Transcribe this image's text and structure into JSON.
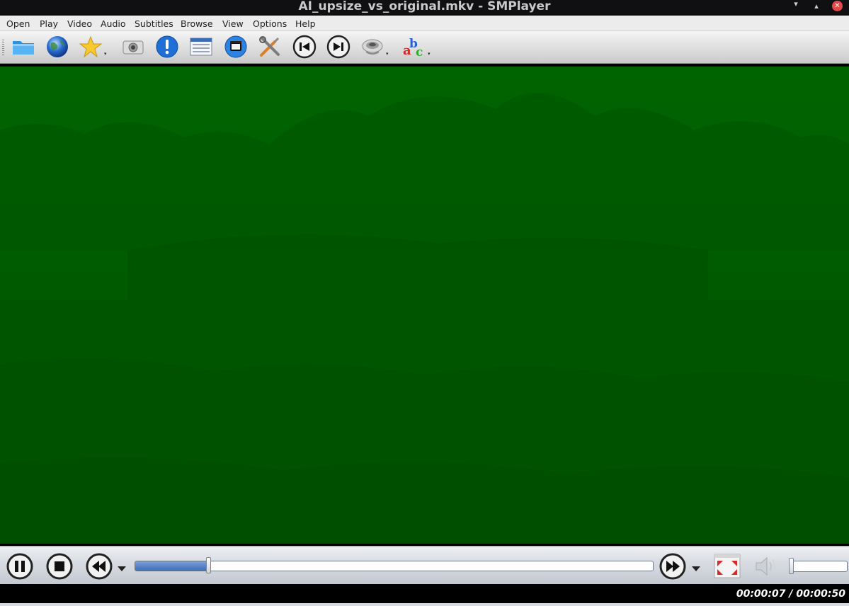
{
  "window": {
    "title": "AI_upsize_vs_original.mkv - SMPlayer",
    "controls": [
      "minimize-icon",
      "maximize-icon",
      "close-icon"
    ]
  },
  "menubar": {
    "items": [
      {
        "label": "Open"
      },
      {
        "label": "Play"
      },
      {
        "label": "Video"
      },
      {
        "label": "Audio"
      },
      {
        "label": "Subtitles"
      },
      {
        "label": "Browse"
      },
      {
        "label": "View"
      },
      {
        "label": "Options"
      },
      {
        "label": "Help"
      }
    ]
  },
  "toolbar": {
    "buttons": [
      {
        "icon": "open-folder-icon"
      },
      {
        "icon": "globe-url-icon"
      },
      {
        "icon": "favorites-star-icon",
        "has_menu": true
      },
      {
        "icon": "screenshot-camera-icon"
      },
      {
        "icon": "info-icon"
      },
      {
        "icon": "playlist-icon"
      },
      {
        "icon": "video-equalizer-icon"
      },
      {
        "icon": "preferences-tools-icon"
      },
      {
        "icon": "previous-track-icon"
      },
      {
        "icon": "next-track-icon"
      },
      {
        "icon": "audio-track-icon",
        "has_menu": true
      },
      {
        "icon": "subtitles-abc-icon",
        "has_menu": true
      }
    ]
  },
  "video": {
    "tint_color": "#005e00"
  },
  "controls": {
    "seek_progress": 0.14,
    "volume_level": 0.0,
    "buttons": [
      "pause-icon",
      "stop-icon",
      "rewind-icon",
      "forward-icon",
      "fullscreen-icon",
      "volume-icon"
    ]
  },
  "status": {
    "time": "00:00:07 / 00:00:50"
  }
}
